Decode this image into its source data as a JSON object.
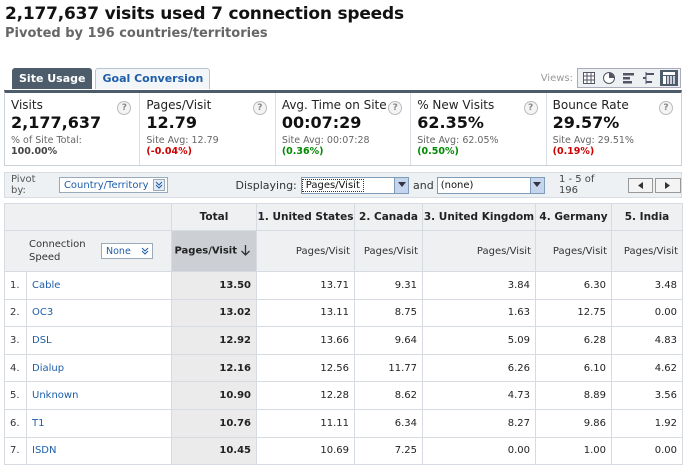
{
  "header": {
    "title": "2,177,637 visits used 7 connection speeds",
    "subtitle": "Pivoted by 196 countries/territories"
  },
  "tabs": [
    {
      "label": "Site Usage",
      "active": true
    },
    {
      "label": "Goal Conversion",
      "active": false
    }
  ],
  "views": {
    "label": "Views:",
    "buttons": [
      "table-view-icon",
      "pie-chart-icon",
      "bar-chart-icon",
      "comparison-icon",
      "pivot-icon"
    ],
    "active": "pivot-icon"
  },
  "scorecards": [
    {
      "label": "Visits",
      "value": "2,177,637",
      "sub": "% of Site Total:",
      "sub_value": "100.00%",
      "delta": ""
    },
    {
      "label": "Pages/Visit",
      "value": "12.79",
      "sub": "Site Avg:",
      "sub_value": "12.79",
      "delta": "(-0.04%)",
      "delta_type": "neg"
    },
    {
      "label": "Avg. Time on Site",
      "value": "00:07:29",
      "sub": "Site Avg:",
      "sub_value": "00:07:28",
      "delta": "(0.36%)",
      "delta_type": "pos"
    },
    {
      "label": "% New Visits",
      "value": "62.35%",
      "sub": "Site Avg:",
      "sub_value": "62.05%",
      "delta": "(0.50%)",
      "delta_type": "pos"
    },
    {
      "label": "Bounce Rate",
      "value": "29.57%",
      "sub": "Site Avg:",
      "sub_value": "29.51%",
      "delta": "(0.19%)",
      "delta_type": "neg"
    }
  ],
  "controls": {
    "pivot_label": "Pivot by:",
    "pivot_value": "Country/Territory",
    "displaying_label": "Displaying:",
    "metric1": "Pages/Visit",
    "and_label": "and",
    "metric2": "(none)",
    "pager_text": "1 - 5 of 196"
  },
  "table": {
    "total_header": "Total",
    "row_dim_label": "Connection Speed",
    "secondary_select": "None",
    "sort_metric": "Pages/Visit",
    "metric": "Pages/Visit",
    "columns": [
      "1. United States",
      "2. Canada",
      "3. United Kingdom",
      "4. Germany",
      "5. India"
    ],
    "rows": [
      {
        "idx": "1.",
        "name": "Cable",
        "total": "13.50",
        "values": [
          "13.71",
          "9.31",
          "3.84",
          "6.30",
          "3.48"
        ]
      },
      {
        "idx": "2.",
        "name": "OC3",
        "total": "13.02",
        "values": [
          "13.11",
          "8.75",
          "1.63",
          "12.75",
          "0.00"
        ]
      },
      {
        "idx": "3.",
        "name": "DSL",
        "total": "12.92",
        "values": [
          "13.66",
          "9.64",
          "5.09",
          "6.28",
          "4.83"
        ]
      },
      {
        "idx": "4.",
        "name": "Dialup",
        "total": "12.16",
        "values": [
          "12.56",
          "11.77",
          "6.26",
          "6.10",
          "4.62"
        ]
      },
      {
        "idx": "5.",
        "name": "Unknown",
        "total": "10.90",
        "values": [
          "12.28",
          "8.62",
          "4.73",
          "8.89",
          "3.56"
        ]
      },
      {
        "idx": "6.",
        "name": "T1",
        "total": "10.76",
        "values": [
          "11.11",
          "6.34",
          "8.27",
          "9.86",
          "1.92"
        ]
      },
      {
        "idx": "7.",
        "name": "ISDN",
        "total": "10.45",
        "values": [
          "10.69",
          "7.25",
          "0.00",
          "1.00",
          "0.00"
        ]
      }
    ]
  }
}
